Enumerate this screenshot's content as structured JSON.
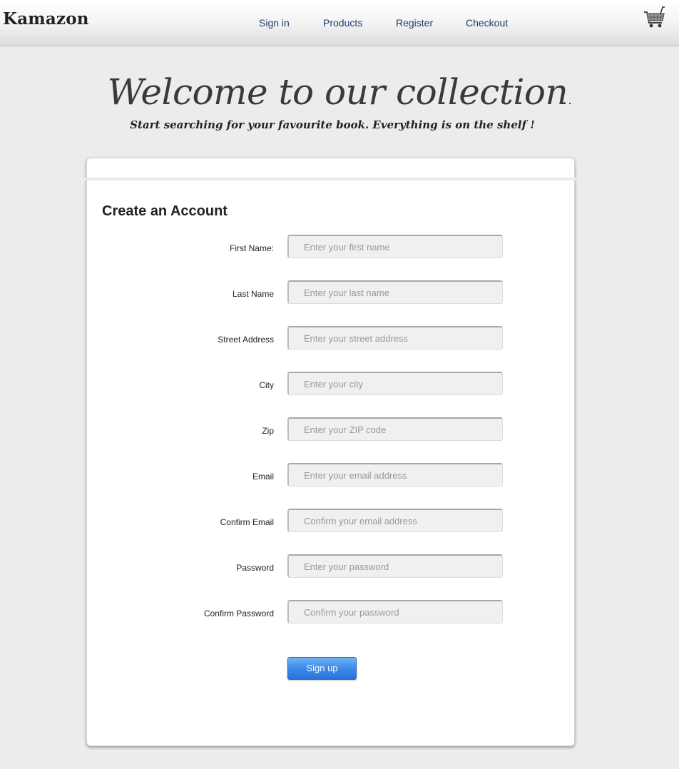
{
  "header": {
    "logo": "Kamazon",
    "nav": [
      {
        "label": "Sign in"
      },
      {
        "label": "Products"
      },
      {
        "label": "Register"
      },
      {
        "label": "Checkout"
      }
    ],
    "cart_icon": "shopping-cart-icon"
  },
  "hero": {
    "title": "Welcome to our collection",
    "subtitle": "Start searching for your favourite book. Everything is on the shelf !"
  },
  "form": {
    "title": "Create an Account",
    "fields": [
      {
        "label": "First Name:",
        "placeholder": "Enter your first name",
        "value": ""
      },
      {
        "label": "Last Name",
        "placeholder": "Enter your last name",
        "value": ""
      },
      {
        "label": "Street Address",
        "placeholder": "Enter your street address",
        "value": ""
      },
      {
        "label": "City",
        "placeholder": "Enter your city",
        "value": ""
      },
      {
        "label": "Zip",
        "placeholder": "Enter your ZIP code",
        "value": ""
      },
      {
        "label": "Email",
        "placeholder": "Enter your email address",
        "value": ""
      },
      {
        "label": "Confirm Email",
        "placeholder": "Confirm your email address",
        "value": ""
      },
      {
        "label": "Password",
        "placeholder": "Enter your password",
        "value": ""
      },
      {
        "label": "Confirm Password",
        "placeholder": "Confirm your password",
        "value": ""
      }
    ],
    "submit_label": "Sign up"
  },
  "colors": {
    "nav_link": "#1f3c6e",
    "button": "#3d8ae9",
    "background": "#ececec"
  }
}
